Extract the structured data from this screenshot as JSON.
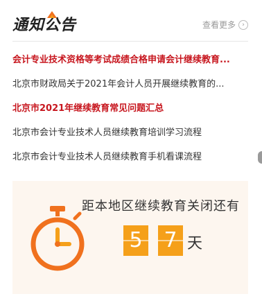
{
  "header": {
    "title": "通知公告",
    "more_label": "查看更多",
    "more_icon": "chevron-right-icon"
  },
  "news": [
    {
      "text": "会计专业技术资格等考试成绩合格申请会计继续教育...",
      "style": "hot"
    },
    {
      "text": "北京市财政局关于2021年会计人员开展继续教育的...",
      "style": "normal"
    },
    {
      "text": "北京市2021年继续教育常见问题汇总",
      "style": "hot"
    },
    {
      "text": "北京市会计专业技术人员继续教育培训学习流程",
      "style": "normal"
    },
    {
      "text": "北京市会计专业技术人员继续教育手机看课流程",
      "style": "normal"
    }
  ],
  "countdown": {
    "label": "距本地区继续教育关闭还有",
    "digits": [
      "5",
      "7"
    ],
    "unit": "天",
    "icon": "stopwatch-icon"
  },
  "colors": {
    "accent_red": "#c7161e",
    "orange": "#f5a01a",
    "clock_orange": "#f0711e"
  }
}
